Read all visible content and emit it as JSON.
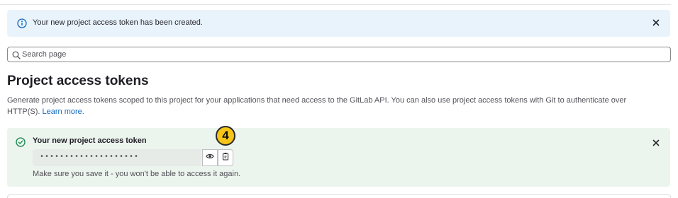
{
  "info_alert": {
    "message": "Your new project access token has been created."
  },
  "search": {
    "placeholder": "Search page",
    "value": ""
  },
  "page": {
    "title": "Project access tokens",
    "description": "Generate project access tokens scoped to this project for your applications that need access to the GitLab API. You can also use project access tokens with Git to authenticate over HTTP(S).",
    "learn_more": "Learn more."
  },
  "token_alert": {
    "title": "Your new project access token",
    "masked_token": "••••••••••••••••••••",
    "note": "Make sure you save it - you won't be able to access it again."
  },
  "step_badge": "4",
  "icons": {
    "info": "info-icon",
    "close": "close-icon",
    "search": "search-icon",
    "success": "check-circle-icon",
    "reveal": "eye-icon",
    "copy": "clipboard-icon"
  },
  "colors": {
    "info_bg": "#e9f3fc",
    "success_bg": "#ecf4ee",
    "link": "#1068bf",
    "badge": "#f5c518"
  }
}
